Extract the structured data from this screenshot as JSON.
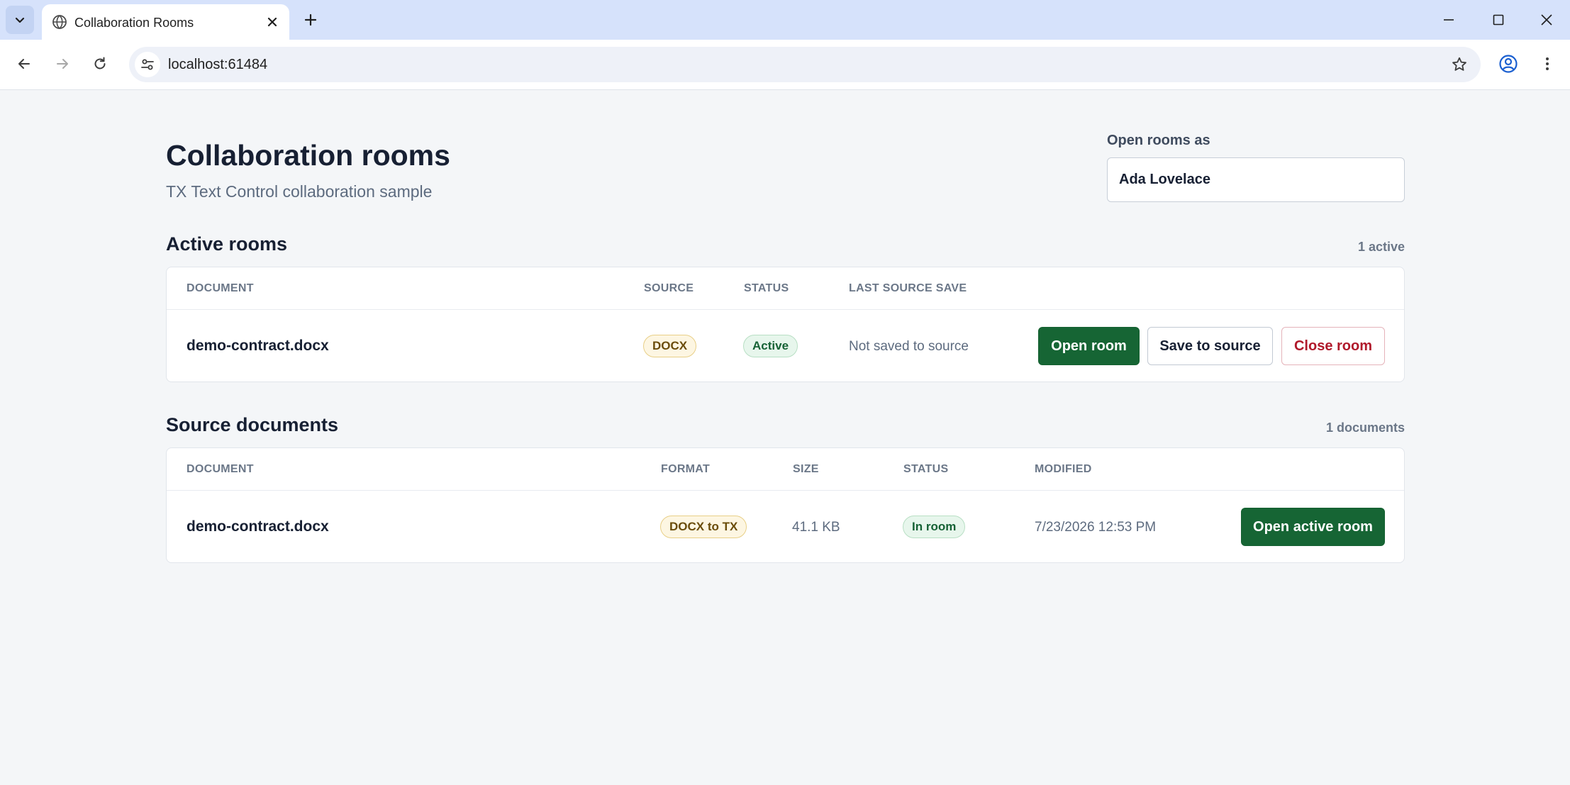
{
  "browser": {
    "tab_title": "Collaboration Rooms",
    "url": "localhost:61484"
  },
  "page": {
    "title": "Collaboration rooms",
    "subtitle": "TX Text Control collaboration sample",
    "open_as_label": "Open rooms as",
    "open_as_value": "Ada Lovelace"
  },
  "active_rooms": {
    "title": "Active rooms",
    "count": "1 active",
    "columns": [
      "DOCUMENT",
      "SOURCE",
      "STATUS",
      "LAST SOURCE SAVE"
    ],
    "rows": [
      {
        "document": "demo-contract.docx",
        "source": "DOCX",
        "status": "Active",
        "last_save": "Not saved to source",
        "actions": {
          "open": "Open room",
          "save": "Save to source",
          "close": "Close room"
        }
      }
    ]
  },
  "source_documents": {
    "title": "Source documents",
    "count": "1 documents",
    "columns": [
      "DOCUMENT",
      "FORMAT",
      "SIZE",
      "STATUS",
      "MODIFIED"
    ],
    "rows": [
      {
        "document": "demo-contract.docx",
        "format": "DOCX to TX",
        "size": "41.1 KB",
        "status": "In room",
        "modified": "7/23/2026 12:53 PM",
        "action": "Open active room"
      }
    ]
  },
  "colors": {
    "primary": "#166534",
    "danger": "#b0192b",
    "page_background": "#f4f6f8"
  }
}
